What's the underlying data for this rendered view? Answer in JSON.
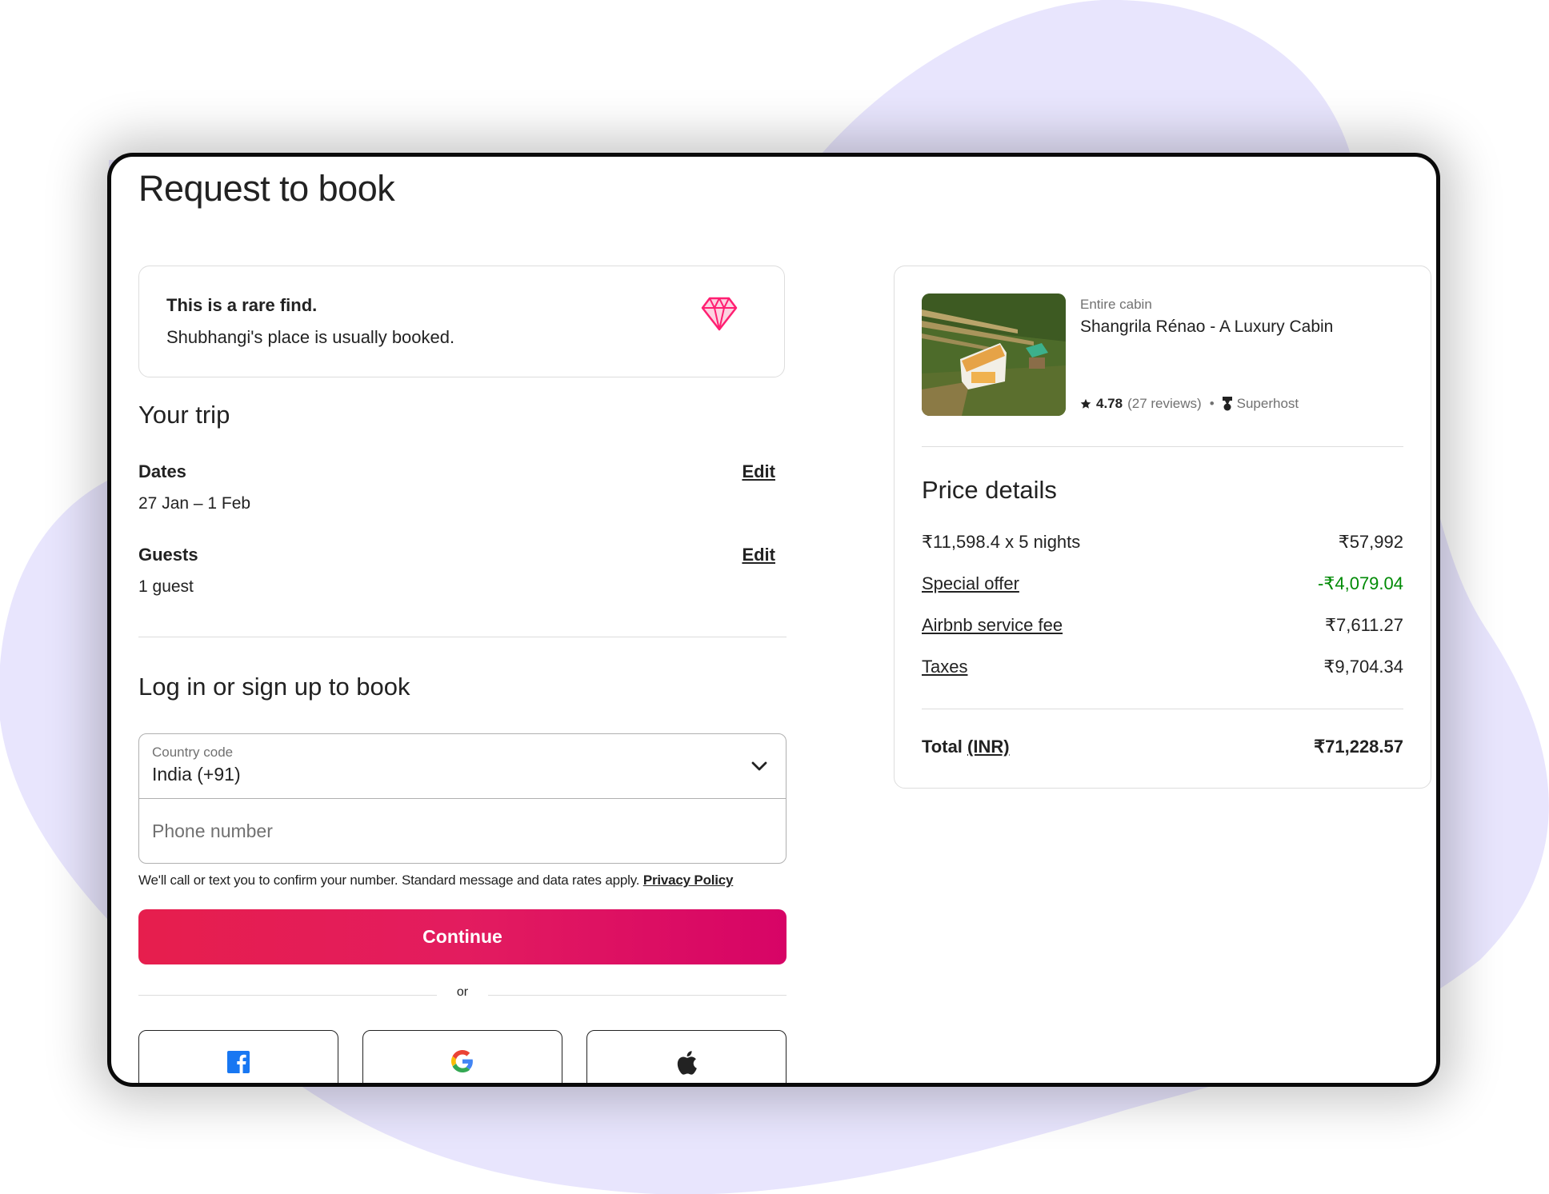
{
  "page": {
    "title": "Request to book"
  },
  "rare_find": {
    "title": "This is a rare find.",
    "subtitle": "Shubhangi's place is usually booked.",
    "icon": "diamond-icon"
  },
  "trip": {
    "heading": "Your trip",
    "dates": {
      "label": "Dates",
      "value": "27 Jan – 1 Feb",
      "edit_label": "Edit"
    },
    "guests": {
      "label": "Guests",
      "value": "1 guest",
      "edit_label": "Edit"
    }
  },
  "login": {
    "heading": "Log in or sign up to book",
    "country_code": {
      "label": "Country code",
      "value": "India (+91)",
      "icon": "chevron-down-icon"
    },
    "phone": {
      "placeholder": "Phone number",
      "value": ""
    },
    "note": "We'll call or text you to confirm your number. Standard message and data rates apply.",
    "privacy_link": "Privacy Policy",
    "continue_label": "Continue",
    "or_label": "or",
    "social": [
      {
        "name": "facebook",
        "icon": "facebook-icon"
      },
      {
        "name": "google",
        "icon": "google-icon"
      },
      {
        "name": "apple",
        "icon": "apple-icon"
      }
    ]
  },
  "listing": {
    "type": "Entire cabin",
    "name": "Shangrila Rénao - A Luxury Cabin",
    "rating": "4.78",
    "reviews": "(27 reviews)",
    "separator": "•",
    "badge": "Superhost"
  },
  "price_details": {
    "heading": "Price details",
    "rows": [
      {
        "label": "₹11,598.4 x 5 nights",
        "amount": "₹57,992",
        "link": false
      },
      {
        "label": "Special offer",
        "amount": "-₹4,079.04",
        "link": true,
        "highlight": true
      },
      {
        "label": "Airbnb service fee",
        "amount": "₹7,611.27",
        "link": true
      },
      {
        "label": "Taxes",
        "amount": "₹9,704.34",
        "link": true
      }
    ],
    "total": {
      "label": "Total",
      "currency": "(INR)",
      "amount": "₹71,228.57"
    }
  },
  "colors": {
    "brand": "#e31c5f",
    "discount": "#008a05",
    "background_blob": "#e8e5fd",
    "text": "#222222",
    "muted": "#717171",
    "border": "#dddddd"
  }
}
